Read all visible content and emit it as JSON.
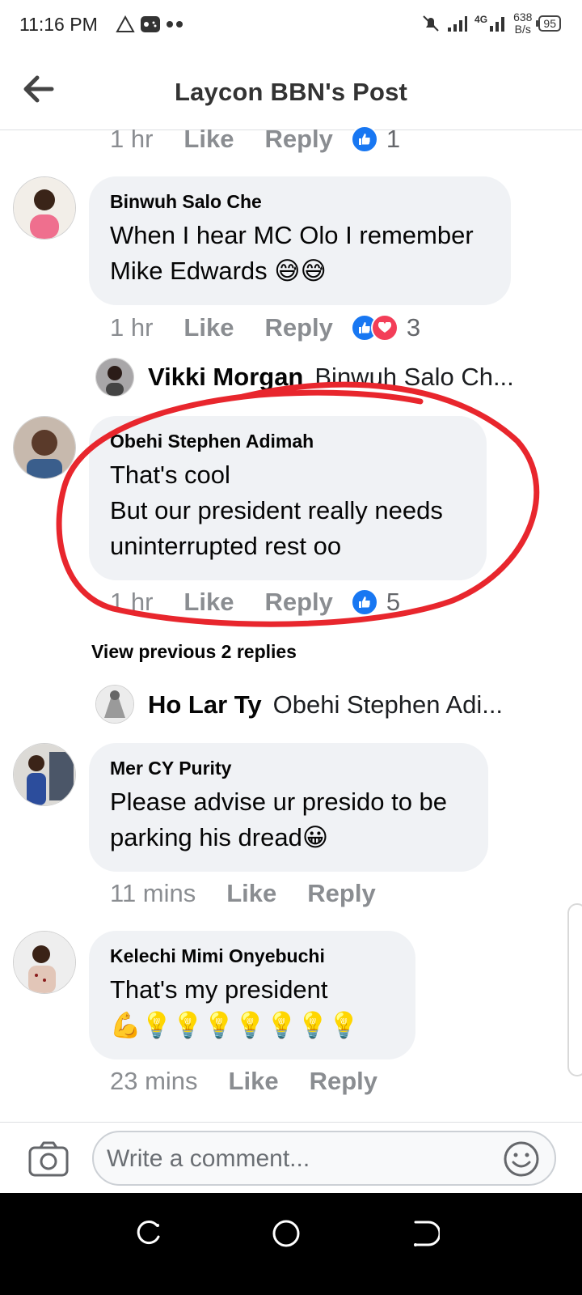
{
  "status_bar": {
    "time": "11:16 PM",
    "network_speed_value": "638",
    "network_speed_unit": "B/s",
    "network_type": "4G",
    "battery": "95"
  },
  "header": {
    "title": "Laycon BBN's Post",
    "back_icon": "arrow-left-icon"
  },
  "first_meta": {
    "time": "1 hr",
    "like": "Like",
    "reply": "Reply",
    "reactions": [
      "like"
    ],
    "count": "1"
  },
  "comments": [
    {
      "name": "Binwuh Salo Che",
      "text_line1": "When I hear MC Olo I remember",
      "text_line2": "Mike Edwards 😅😅",
      "time": "1 hr",
      "like": "Like",
      "reply": "Reply",
      "reactions": [
        "like",
        "love"
      ],
      "count": "3",
      "reply_preview": {
        "name": "Vikki Morgan",
        "text": "Binwuh Salo Ch..."
      }
    },
    {
      "name": "Obehi Stephen Adimah",
      "text_line1": "That's cool",
      "text_line2": "But our president really needs",
      "text_line3": "uninterrupted rest oo",
      "time": "1 hr",
      "like": "Like",
      "reply": "Reply",
      "reactions": [
        "like"
      ],
      "count": "5",
      "view_previous": "View previous 2 replies",
      "reply_preview": {
        "name": "Ho Lar Ty",
        "text": "Obehi Stephen Adi..."
      }
    },
    {
      "name": "Mer CY Purity",
      "text_line1": "Please advise ur presido to be",
      "text_line2": "parking his dread😀",
      "time": "11 mins",
      "like": "Like",
      "reply": "Reply"
    },
    {
      "name": "Kelechi Mimi Onyebuchi",
      "text_line1": "That's my president",
      "text_line2": "💪💡💡💡💡💡💡💡",
      "time": "23 mins",
      "like": "Like",
      "reply": "Reply"
    }
  ],
  "composer": {
    "placeholder": "Write a comment...",
    "camera_icon": "camera-icon",
    "emoji_icon": "smiley-icon"
  },
  "colors": {
    "like_blue": "#1877f2",
    "love_red": "#f33e58",
    "bubble_bg": "#f0f2f5",
    "annotation_red": "#e8262d",
    "meta_gray": "#8a8d91"
  }
}
